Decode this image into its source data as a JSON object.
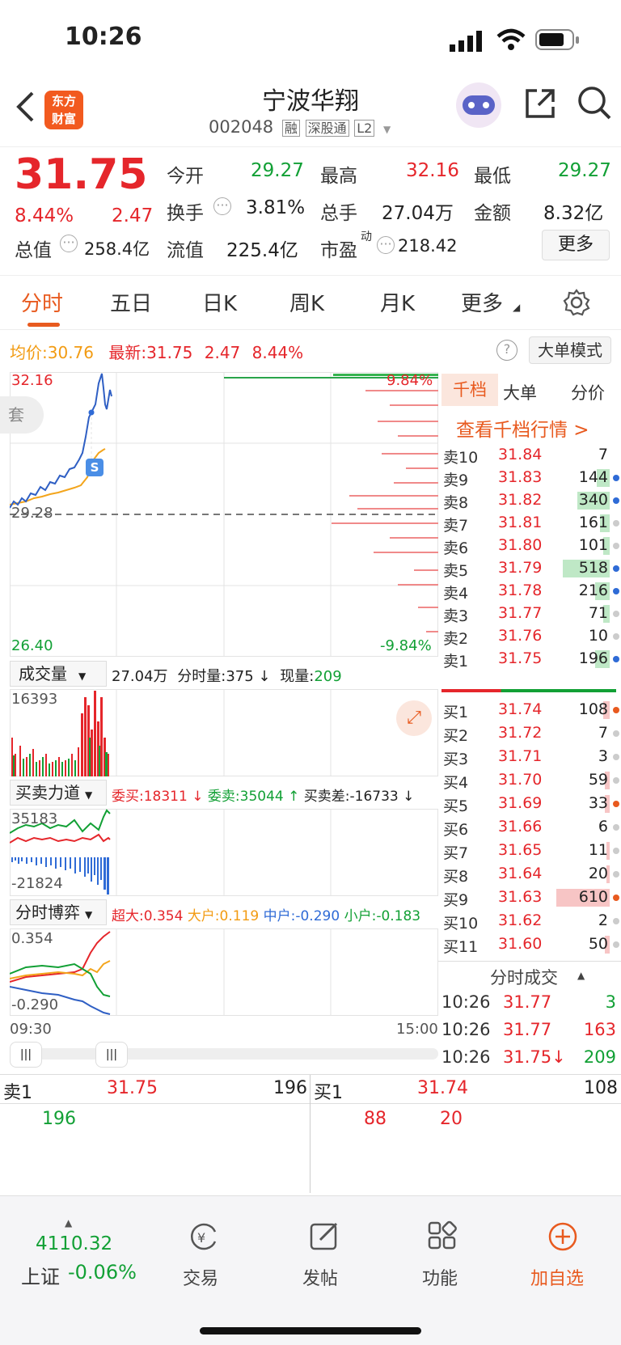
{
  "status": {
    "time": "10:26"
  },
  "header": {
    "title": "宁波华翔",
    "code": "002048",
    "badges": [
      "融",
      "深股通",
      "L2"
    ]
  },
  "quote": {
    "price": "31.75",
    "pct": "8.44%",
    "chg": "2.47",
    "fields": [
      {
        "k": "今开",
        "v": "29.27"
      },
      {
        "k": "最高",
        "v": "32.16"
      },
      {
        "k": "最低",
        "v": "29.27"
      },
      {
        "k": "换手",
        "v": "3.81%"
      },
      {
        "k": "总手",
        "v": "27.04万"
      },
      {
        "k": "金额",
        "v": "8.32亿"
      },
      {
        "k": "总值",
        "v": "258.4亿"
      },
      {
        "k": "流值",
        "v": "225.4亿"
      },
      {
        "k": "市盈",
        "sup": "动",
        "v": "218.42"
      }
    ],
    "more": "更多"
  },
  "tabs": [
    "分时",
    "五日",
    "日K",
    "周K",
    "月K",
    "更多"
  ],
  "infoline": {
    "avg_label": "均价:",
    "avg": "30.76",
    "last_label": "最新:",
    "last": "31.75",
    "chg": "2.47",
    "pct": "8.44%",
    "mode": "大单模式"
  },
  "chart": {
    "high": "32.16",
    "base": "29.28",
    "low": "26.40",
    "pct_up": "9.84%",
    "pct_down": "-9.84%",
    "tag": "套",
    "marker": "S"
  },
  "volume": {
    "label": "成交量",
    "total": "27.04万",
    "cur_label": "分时量:",
    "cur": "375",
    "now_label": "现量:",
    "now": "209",
    "max": "16393"
  },
  "force": {
    "label": "买卖力道",
    "buy_label": "委买:",
    "buy": "18311",
    "sell_label": "委卖:",
    "sell": "35044",
    "diff_label": "买卖差:",
    "diff": "-16733",
    "top": "35183",
    "bottom": "-21824"
  },
  "game": {
    "label": "分时博弈",
    "items": [
      {
        "k": "超大:",
        "v": "0.354"
      },
      {
        "k": "大户:",
        "v": "0.119"
      },
      {
        "k": "中户:",
        "v": "-0.290"
      },
      {
        "k": "小户:",
        "v": "-0.183"
      }
    ],
    "top": "0.354",
    "bottom": "-0.290"
  },
  "timeaxis": {
    "start": "09:30",
    "end": "15:00"
  },
  "orderbook": {
    "tabs": [
      "千档",
      "大单",
      "分价"
    ],
    "link": "查看千档行情 >",
    "asks": [
      {
        "k": "卖10",
        "p": "31.84",
        "q": "7"
      },
      {
        "k": "卖9",
        "p": "31.83",
        "q": "144"
      },
      {
        "k": "卖8",
        "p": "31.82",
        "q": "340"
      },
      {
        "k": "卖7",
        "p": "31.81",
        "q": "161"
      },
      {
        "k": "卖6",
        "p": "31.80",
        "q": "101"
      },
      {
        "k": "卖5",
        "p": "31.79",
        "q": "518"
      },
      {
        "k": "卖4",
        "p": "31.78",
        "q": "216"
      },
      {
        "k": "卖3",
        "p": "31.77",
        "q": "71"
      },
      {
        "k": "卖2",
        "p": "31.76",
        "q": "10"
      },
      {
        "k": "卖1",
        "p": "31.75",
        "q": "196"
      }
    ],
    "bids": [
      {
        "k": "买1",
        "p": "31.74",
        "q": "108"
      },
      {
        "k": "买2",
        "p": "31.72",
        "q": "7"
      },
      {
        "k": "买3",
        "p": "31.71",
        "q": "3"
      },
      {
        "k": "买4",
        "p": "31.70",
        "q": "59"
      },
      {
        "k": "买5",
        "p": "31.69",
        "q": "33"
      },
      {
        "k": "买6",
        "p": "31.66",
        "q": "6"
      },
      {
        "k": "买7",
        "p": "31.65",
        "q": "11"
      },
      {
        "k": "买8",
        "p": "31.64",
        "q": "20"
      },
      {
        "k": "买9",
        "p": "31.63",
        "q": "610"
      },
      {
        "k": "买10",
        "p": "31.62",
        "q": "2"
      },
      {
        "k": "买11",
        "p": "31.60",
        "q": "50"
      }
    ]
  },
  "trades": {
    "title": "分时成交",
    "rows": [
      {
        "t": "10:26",
        "p": "31.77",
        "q": "3"
      },
      {
        "t": "10:26",
        "p": "31.77",
        "q": "163"
      },
      {
        "t": "10:26",
        "p": "31.75↓",
        "q": "209"
      }
    ]
  },
  "queue": {
    "sell_label": "卖1",
    "sell_price": "31.75",
    "sell_qty": "196",
    "buy_label": "买1",
    "buy_price": "31.74",
    "buy_qty": "108",
    "sell_orders": [
      "196"
    ],
    "buy_orders": [
      "88",
      "20"
    ]
  },
  "nav": {
    "index_val": "4110.32",
    "index_name": "上证",
    "index_pct": "-0.06%",
    "items": [
      "交易",
      "发帖",
      "功能",
      "加自选"
    ]
  }
}
